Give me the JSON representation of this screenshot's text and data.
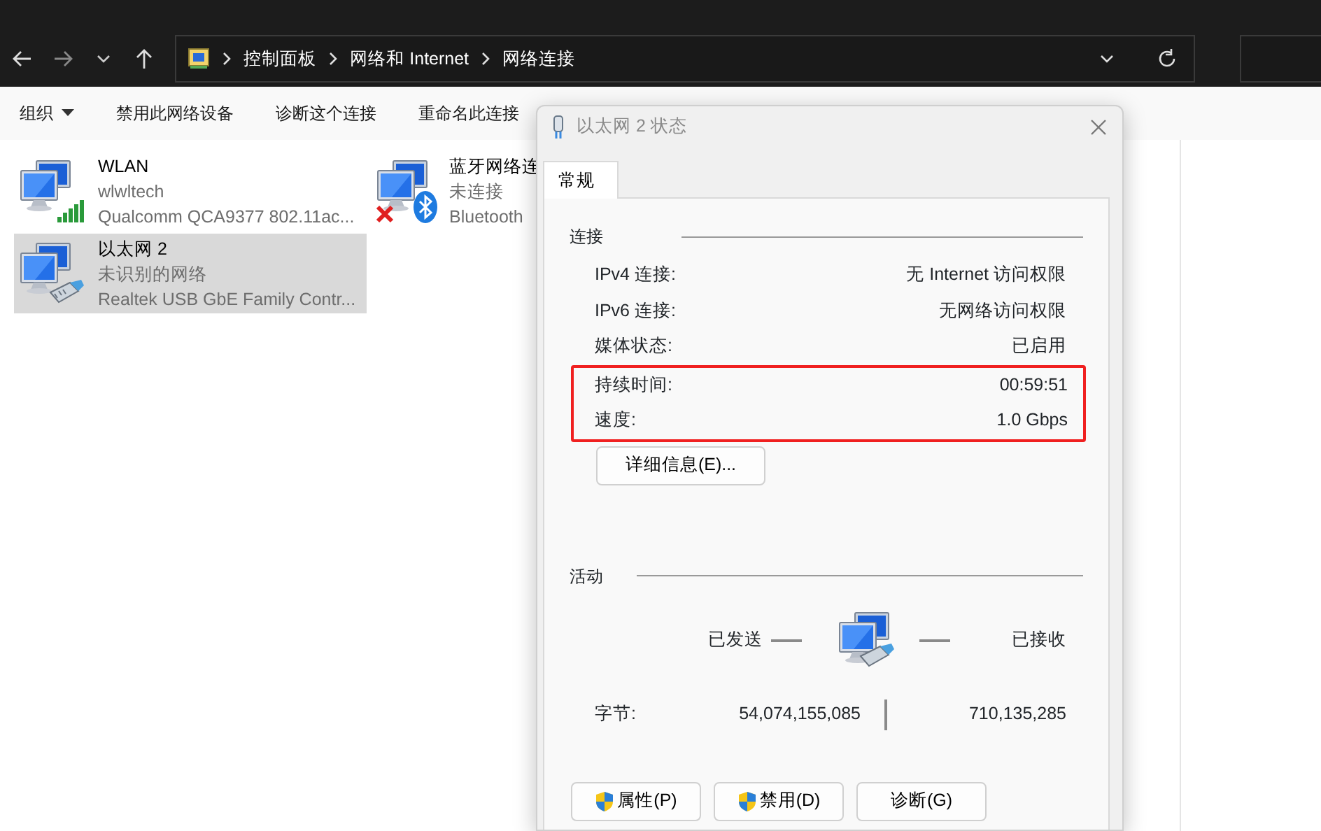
{
  "address_bar": {
    "breadcrumbs": [
      "控制面板",
      "网络和 Internet",
      "网络连接"
    ]
  },
  "toolbar": [
    {
      "label": "组织",
      "dropdown": true
    },
    {
      "label": "禁用此网络设备",
      "dropdown": false
    },
    {
      "label": "诊断这个连接",
      "dropdown": false
    },
    {
      "label": "重命名此连接",
      "dropdown": false
    }
  ],
  "connections": [
    {
      "kind": "wifi",
      "name": "WLAN",
      "status": "wlwltech",
      "adapter": "Qualcomm QCA9377 802.11ac...",
      "selected": false,
      "disconnected": false
    },
    {
      "kind": "bluetooth",
      "name": "蓝牙网络连",
      "status": "未连接",
      "adapter": "Bluetooth",
      "selected": false,
      "disconnected": true
    },
    {
      "kind": "ethernet",
      "name": "以太网 2",
      "status": "未识别的网络",
      "adapter": "Realtek USB GbE Family Contr...",
      "selected": true,
      "disconnected": false
    }
  ],
  "dialog": {
    "title": "以太网 2 状态",
    "tabs": [
      {
        "label": "常规",
        "selected": true
      }
    ],
    "connection": {
      "heading": "连接",
      "rows": [
        {
          "label": "IPv4 连接:",
          "value": "无 Internet 访问权限",
          "highlighted": false
        },
        {
          "label": "IPv6 连接:",
          "value": "无网络访问权限",
          "highlighted": false
        },
        {
          "label": "媒体状态:",
          "value": "已启用",
          "highlighted": false
        },
        {
          "label": "持续时间:",
          "value": "00:59:51",
          "highlighted": true
        },
        {
          "label": "速度:",
          "value": "1.0 Gbps",
          "highlighted": true
        }
      ],
      "details_button": "详细信息(E)..."
    },
    "activity": {
      "heading": "活动",
      "sent_label": "已发送",
      "received_label": "已接收",
      "bytes_label": "字节:",
      "bytes_sent": "54,074,155,085",
      "bytes_received": "710,135,285"
    },
    "buttons": [
      {
        "label": "属性(P)",
        "shield": true
      },
      {
        "label": "禁用(D)",
        "shield": true
      },
      {
        "label": "诊断(G)",
        "shield": false
      }
    ]
  }
}
